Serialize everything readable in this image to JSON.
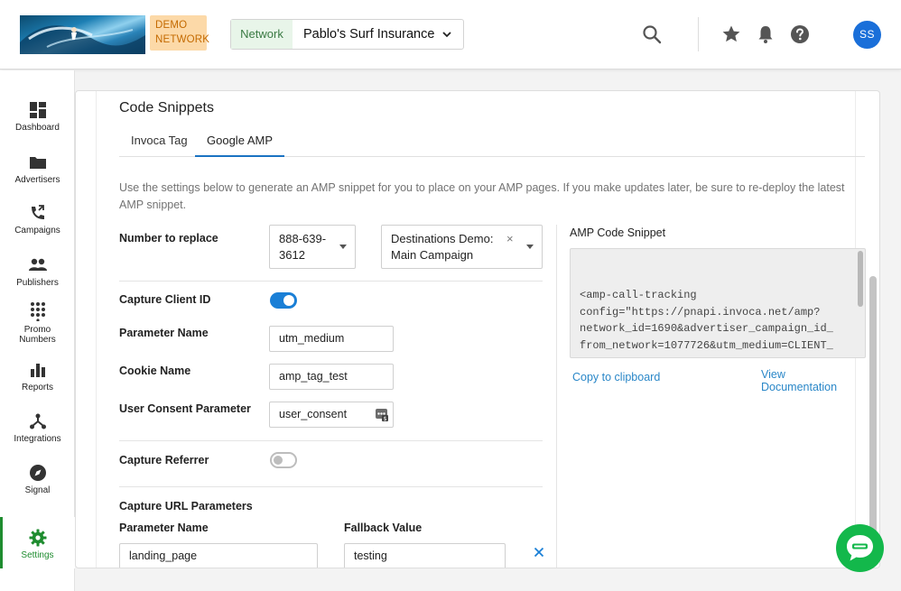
{
  "header": {
    "demo_badge_line1": "DEMO",
    "demo_badge_line2": "NETWORK",
    "network_label": "Network",
    "network_value": "Pablo's Surf Insurance",
    "avatar_initials": "SS",
    "icons": [
      "search-icon",
      "star-icon",
      "bell-icon",
      "help-icon"
    ]
  },
  "sidebar": {
    "items": [
      {
        "label": "Dashboard",
        "icon": "dashboard-icon"
      },
      {
        "label": "Advertisers",
        "icon": "folder-icon"
      },
      {
        "label": "Campaigns",
        "icon": "phone-forward-icon"
      },
      {
        "label": "Publishers",
        "icon": "people-icon"
      },
      {
        "label": "Promo\nNumbers",
        "label_line1": "Promo",
        "label_line2": "Numbers",
        "icon": "dialpad-icon"
      },
      {
        "label": "Reports",
        "icon": "bar-chart-icon"
      },
      {
        "label": "Integrations",
        "icon": "integrations-icon"
      },
      {
        "label": "Signal",
        "icon": "compass-icon"
      },
      {
        "label": "Settings",
        "icon": "gear-icon",
        "active": true
      }
    ],
    "accent": "#1e8c2f"
  },
  "main": {
    "title": "Code Snippets",
    "tabs": [
      {
        "label": "Invoca Tag",
        "active": false
      },
      {
        "label": "Google AMP",
        "active": true
      }
    ],
    "description": "Use the settings below to generate an AMP snippet for you to place on your AMP pages. If you make updates later, be sure to re-deploy the latest AMP snippet.",
    "number_to_replace": {
      "label": "Number to replace",
      "number_line1": "888-639-",
      "number_line2": "3612",
      "campaign_line1": "Destinations Demo:",
      "campaign_line2": "Main Campaign",
      "clear_glyph": "×"
    },
    "capture_client_id": {
      "label": "Capture Client ID",
      "enabled": true
    },
    "parameter_name": {
      "label": "Parameter Name",
      "value": "utm_medium"
    },
    "cookie_name": {
      "label": "Cookie Name",
      "value": "amp_tag_test"
    },
    "user_consent": {
      "label": "User Consent Parameter",
      "value": "user_consent"
    },
    "capture_referrer": {
      "label": "Capture Referrer",
      "enabled": false
    },
    "capture_url_params": {
      "label": "Capture URL Parameters",
      "col_parameter": "Parameter Name",
      "col_fallback": "Fallback Value",
      "rows": [
        {
          "parameter": "landing_page",
          "fallback": "testing"
        }
      ]
    },
    "amp": {
      "title": "AMP Code Snippet",
      "code": "<amp-call-tracking\nconfig=\"https://pnapi.invoca.net/amp?\nnetwork_id=1690&advertiser_campaign_id_\nfrom_network=1077726&utm_medium=CLIENT_\nID(amp_tag_test,user_consent)&landing_p\nage=QUERY_PARAM(landing_page,testing)&i",
      "copy_link": "Copy to clipboard",
      "docs_link": "View Documentation"
    }
  },
  "colors": {
    "primary": "#1a7fd6",
    "link": "#2a87c8",
    "chat": "#13b84b",
    "demo_badge_bg": "#fcd9a8",
    "demo_badge_text": "#c46a00"
  }
}
